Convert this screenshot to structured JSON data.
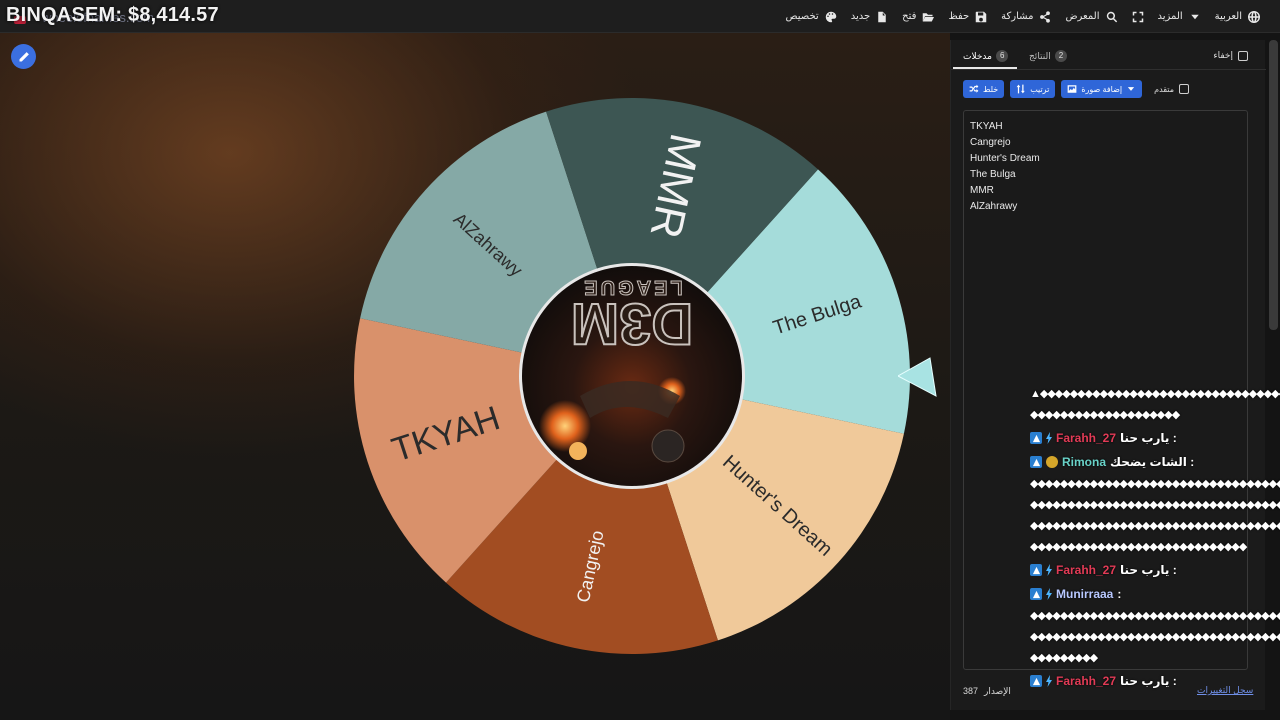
{
  "overlay": {
    "title": "BINQASEM: $8,414.57",
    "sub": "wheelofnames.com"
  },
  "menu": [
    {
      "label": "العربية",
      "icon": "globe-icon"
    },
    {
      "label": "المزيد",
      "icon": "chevron-down-icon"
    },
    {
      "label": "",
      "icon": "fullscreen-icon"
    },
    {
      "label": "المعرض",
      "icon": "search-icon"
    },
    {
      "label": "مشاركة",
      "icon": "share-icon"
    },
    {
      "label": "حفظ",
      "icon": "save-icon"
    },
    {
      "label": "فتح",
      "icon": "folder-open-icon"
    },
    {
      "label": "جديد",
      "icon": "file-icon"
    },
    {
      "label": "تخصيص",
      "icon": "palette-icon"
    }
  ],
  "wheel": {
    "center_logo_line1": "D3M",
    "center_logo_line2": "LEAGUE",
    "segments": [
      {
        "label": "The Bulga",
        "color": "#a5dcda"
      },
      {
        "label": "Hunter's Dream",
        "color": "#f0c99a"
      },
      {
        "label": "Cangrejo",
        "color": "#a24d22"
      },
      {
        "label": "TKYAH",
        "color": "#d9916b"
      },
      {
        "label": "AlZahrawy",
        "color": "#85a9a6"
      },
      {
        "label": "MMR",
        "color": "#3d5653"
      }
    ]
  },
  "panel": {
    "hide_label": "إخفاء",
    "tabs": {
      "entries_label": "مدخلات",
      "entries_count": "6",
      "results_label": "النتائج",
      "results_count": "2"
    },
    "toolbar": {
      "shuffle_label": "خلط",
      "sort_label": "ترتيب",
      "add_image_label": "إضافة صورة",
      "advanced_label": "متقدم"
    },
    "entries": [
      "TKYAH",
      "Cangrejo",
      "Hunter's Dream",
      "The Bulga",
      "MMR",
      "AlZahrawy"
    ],
    "version_label": "الإصدار",
    "version_value": "387",
    "changelog_label": "سجل التغييرات"
  },
  "chat": {
    "blocky_1": "▲◆◆◆◆◆◆◆◆◆◆◆◆◆◆◆◆◆◆◆◆◆◆◆◆◆◆◆◆◆◆◆◆◆◆◆",
    "blocky_1b": "◆◆◆◆◆◆◆◆◆◆◆◆◆◆◆◆◆◆◆◆",
    "messages": [
      {
        "user": "Farahh_27",
        "text": ": يارب حنا",
        "color_class": "user-red",
        "badge": "bits"
      },
      {
        "user": "Rimona",
        "text": ": الشات يضحك",
        "color_class": "user-teal",
        "badge": "sub"
      },
      {
        "user": "Farahh_27",
        "text": ": يارب حنا",
        "color_class": "user-red",
        "badge": "bits"
      },
      {
        "user": "Munirraaa",
        "text": ":",
        "color_class": "user-blue",
        "badge": "bits"
      },
      {
        "user": "Farahh_27",
        "text": ": يارب حنا",
        "color_class": "user-red",
        "badge": "bits"
      }
    ],
    "blocky_2a": "◆◆◆◆◆◆◆◆◆◆◆◆◆◆◆◆◆◆◆◆◆◆◆◆◆◆◆◆◆◆◆◆◆◆◆◆",
    "blocky_2b": "◆◆◆◆◆◆◆◆◆◆◆◆◆◆◆◆◆◆◆◆◆◆◆◆◆◆◆◆◆◆◆◆◆◆◆◆",
    "blocky_2c": "◆◆◆◆◆◆◆◆◆◆◆◆◆◆◆◆◆◆◆◆◆◆◆◆◆◆◆◆◆◆◆◆◆◆◆◆",
    "blocky_2d": "◆◆◆◆◆◆◆◆◆◆◆◆◆◆◆◆◆◆◆◆◆◆◆◆◆◆◆◆◆",
    "blocky_3a": "◆◆◆◆◆◆◆◆◆◆◆◆◆◆◆◆◆◆◆◆◆◆◆◆◆◆◆◆◆◆◆◆◆◆◆◆",
    "blocky_3b": "◆◆◆◆◆◆◆◆◆◆◆◆◆◆◆◆◆◆◆◆◆◆◆◆◆◆◆◆◆◆◆◆◆◆◆◆",
    "blocky_3c": "◆◆◆◆◆◆◆◆◆"
  }
}
